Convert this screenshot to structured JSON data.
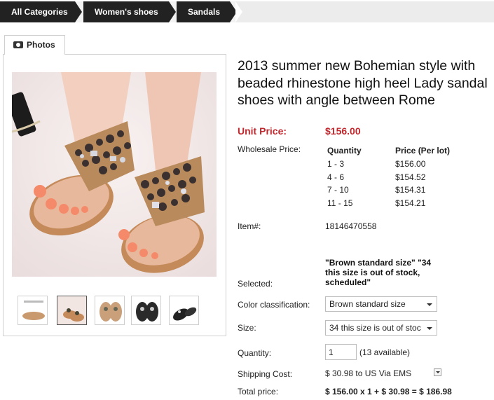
{
  "breadcrumb": {
    "items": [
      "All Categories",
      "Women's shoes",
      "Sandals"
    ]
  },
  "photos": {
    "tab_label": "Photos"
  },
  "product": {
    "title": "2013 summer new Bohemian style with beaded rhinestone high heel Lady sandal shoes with angle between Rome",
    "unit_price_label": "Unit Price:",
    "unit_price": "$156.00",
    "wholesale_label": "Wholesale Price:",
    "wholesale": {
      "headers": [
        "Quantity",
        "Price (Per lot)"
      ],
      "rows": [
        {
          "qty": "1 - 3",
          "price": "$156.00"
        },
        {
          "qty": "4 - 6",
          "price": "$154.52"
        },
        {
          "qty": "7 - 10",
          "price": "$154.31"
        },
        {
          "qty": "11 - 15",
          "price": "$154.21"
        }
      ]
    },
    "item_label": "Item#:",
    "item_number": "18146470558",
    "selected_label": "Selected:",
    "selected_text": "\"Brown standard size\" \"34 this size is out of stock, scheduled\"",
    "color_label": "Color classification:",
    "color_value": "Brown standard size",
    "size_label": "Size:",
    "size_value": "34 this size is out of stoc",
    "quantity_label": "Quantity:",
    "quantity_value": "1",
    "available": "(13 available)",
    "shipping_label": "Shipping Cost:",
    "shipping_value": "$ 30.98 to US Via EMS",
    "total_label": "Total price:",
    "total_value": "$ 156.00 x 1 + $ 30.98 = $ 186.98"
  },
  "colors": {
    "price_red": "#c0282e",
    "breadcrumb_bg": "#222222"
  }
}
